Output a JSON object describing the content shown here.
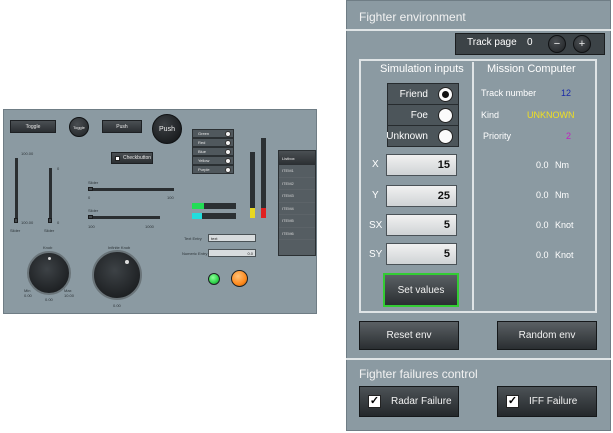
{
  "left": {
    "buttons": {
      "toggle_rect": "Toggle",
      "toggle_round": "Toggle",
      "push_rect": "Push",
      "push_round": "Push",
      "checkbutton": "Checkbutton"
    },
    "vslider1": {
      "top": "100.00",
      "bottom_val": "100.00",
      "label": "Slider"
    },
    "vslider2": {
      "top": "0",
      "bottom_val": "0",
      "label": "Slider"
    },
    "hslider1": {
      "label": "Slider",
      "min": "0",
      "max": "100"
    },
    "hslider2": {
      "label": "Slider",
      "min": "100",
      "max": "1000"
    },
    "radios": [
      "Green",
      "Red",
      "Blue",
      "Yellow",
      "Purple"
    ],
    "text_entry": {
      "label": "Text Entry",
      "value": "text"
    },
    "numeric_entry": {
      "label": "Numeric Entry",
      "value": "0.0"
    },
    "knob1": {
      "label": "Knob",
      "min": "Min\n0.00",
      "max": "Max\n10.00",
      "value": "0.00"
    },
    "knob2": {
      "label": "Infinite Knob",
      "value": "0.00"
    },
    "listbox": {
      "title": "Listbox",
      "items": [
        "ITEM1",
        "ITEM2",
        "ITEM3",
        "ITEM4",
        "ITEM5",
        "ITEM6"
      ]
    },
    "colors": {
      "led_green": "#2fd24a",
      "led_orange": "#ff8a1c",
      "meter_green": "#22dd55",
      "meter_cyan": "#22dddd",
      "meter_yellow": "#e8d820",
      "meter_red": "#e02020"
    }
  },
  "right": {
    "title": "Fighter environment",
    "track_page": {
      "label": "Track page",
      "value": "0",
      "minus": "−",
      "plus": "+"
    },
    "sim_inputs": {
      "title": "Simulation inputs",
      "radios": [
        {
          "label": "Friend",
          "selected": true
        },
        {
          "label": "Foe",
          "selected": false
        },
        {
          "label": "Unknown",
          "selected": false
        }
      ],
      "fields": [
        {
          "label": "X",
          "value": "15"
        },
        {
          "label": "Y",
          "value": "25"
        },
        {
          "label": "SX",
          "value": "5"
        },
        {
          "label": "SY",
          "value": "5"
        }
      ],
      "set_values": "Set values"
    },
    "mission_computer": {
      "title": "Mission Computer",
      "track_number_label": "Track number",
      "track_number_value": "12",
      "kind_label": "Kind",
      "kind_value": "UNKNOWN",
      "priority_label": "Priority",
      "priority_value": "2",
      "readouts": [
        {
          "value": "0.0",
          "unit": "Nm"
        },
        {
          "value": "0.0",
          "unit": "Nm"
        },
        {
          "value": "0.0",
          "unit": "Knot"
        },
        {
          "value": "0.0",
          "unit": "Knot"
        }
      ]
    },
    "reset_env": "Reset env",
    "random_env": "Random env",
    "failures": {
      "title": "Fighter failures control",
      "radar": {
        "label": "Radar Failure",
        "checked": true,
        "mark": "✓"
      },
      "iff": {
        "label": "IFF Failure",
        "checked": true,
        "mark": "✓"
      }
    },
    "colors": {
      "track_number": "#1a2aa8",
      "kind": "#f0e020",
      "priority": "#c020c0",
      "set_values_border": "#33cc33"
    }
  }
}
